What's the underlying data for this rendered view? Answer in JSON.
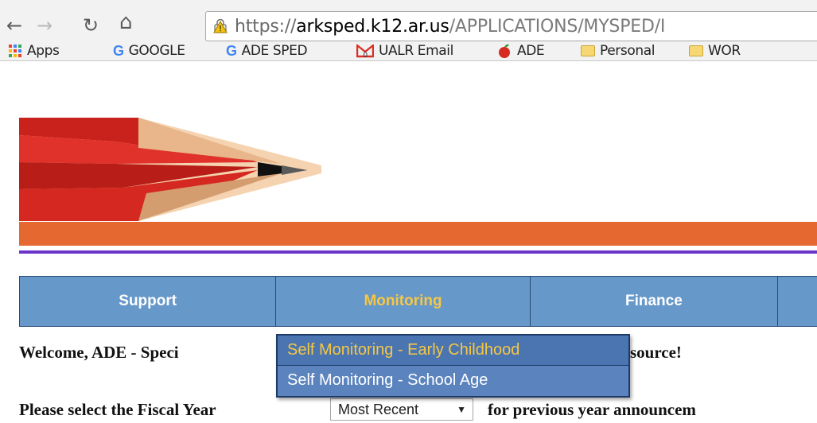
{
  "browser": {
    "url_scheme": "https://",
    "url_host": "arksped.k12.ar.us",
    "url_path": "/APPLICATIONS/MYSPED/I",
    "bookmarks": [
      {
        "label": "Apps",
        "icon": "apps-grid-icon"
      },
      {
        "label": "GOOGLE",
        "icon": "google-icon"
      },
      {
        "label": "ADE SPED",
        "icon": "google-icon"
      },
      {
        "label": "UALR Email",
        "icon": "gmail-icon"
      },
      {
        "label": "ADE",
        "icon": "apple-icon"
      },
      {
        "label": "Personal",
        "icon": "folder-icon"
      },
      {
        "label": "WOR",
        "icon": "folder-icon"
      }
    ]
  },
  "nav": {
    "items": [
      {
        "label": "Support"
      },
      {
        "label": "Monitoring"
      },
      {
        "label": "Finance"
      },
      {
        "label": ""
      }
    ]
  },
  "dropdown": {
    "items": [
      {
        "label": "Self Monitoring - Early Childhood"
      },
      {
        "label": "Self Monitoring - School Age"
      }
    ]
  },
  "page": {
    "welcome_start": "Welcome,  ADE - Speci",
    "welcome_end": "source!",
    "fiscal_prefix": "Please select the Fiscal Year",
    "fiscal_selected": "Most Recent",
    "fiscal_suffix": "for previous year announcem"
  },
  "colors": {
    "nav_bg": "#6698c9",
    "nav_active": "#f6c744",
    "orange_bar": "#e4682f",
    "purple_line": "#6a35c8"
  }
}
